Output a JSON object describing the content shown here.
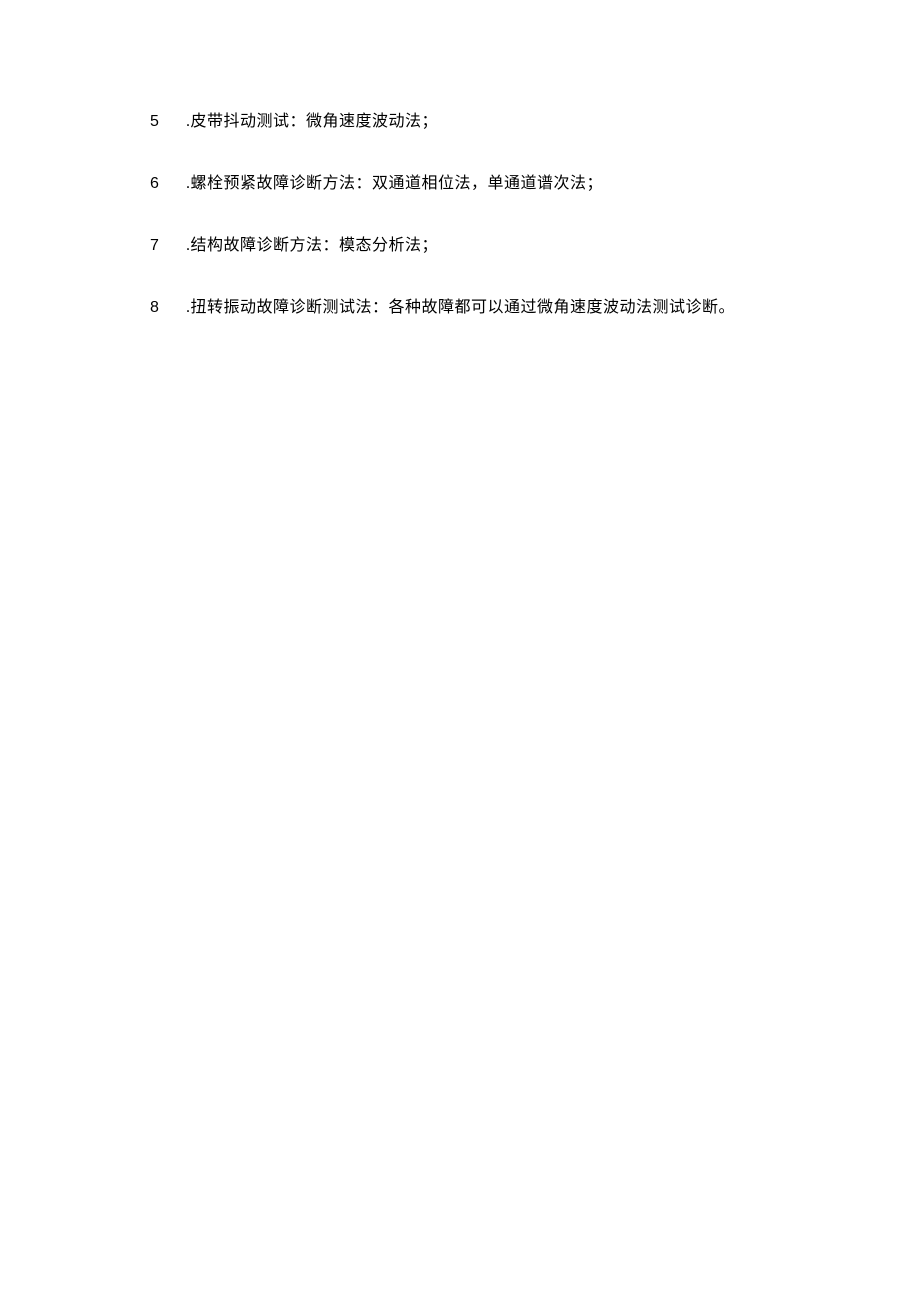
{
  "items": [
    {
      "number": "5",
      "text": ".皮带抖动测试：微角速度波动法；"
    },
    {
      "number": "6",
      "text": ".螺栓预紧故障诊断方法：双通道相位法，单通道谱次法；"
    },
    {
      "number": "7",
      "text": ".结构故障诊断方法：模态分析法；"
    },
    {
      "number": "8",
      "text": ".扭转振动故障诊断测试法：各种故障都可以通过微角速度波动法测试诊断。"
    }
  ]
}
